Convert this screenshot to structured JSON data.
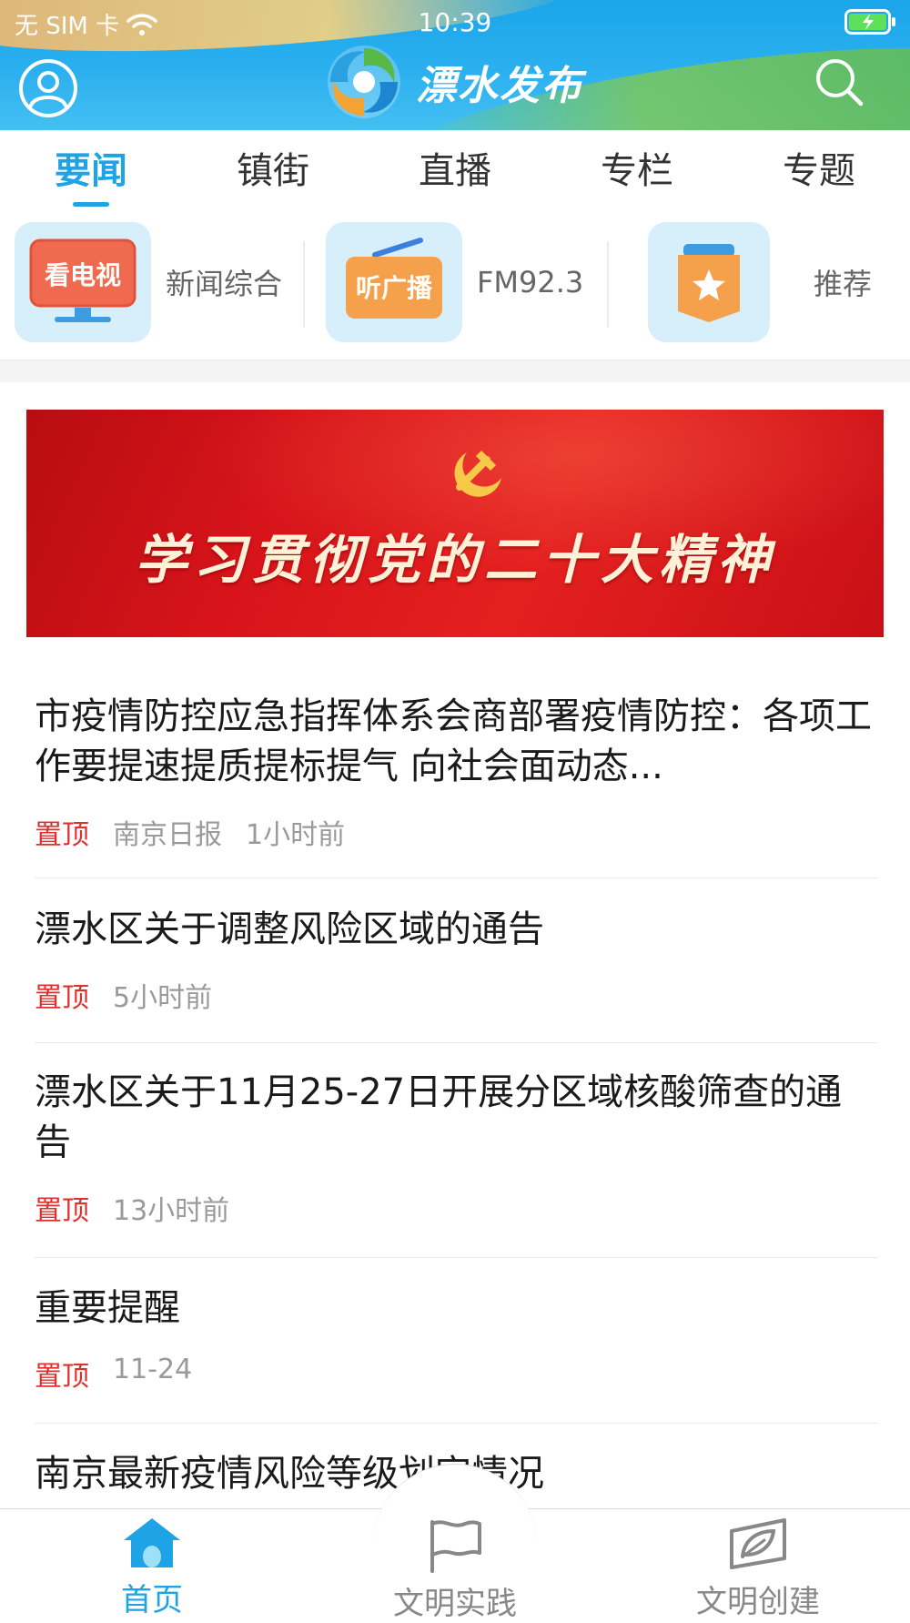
{
  "status_bar": {
    "carrier": "无 SIM 卡",
    "time": "10:39"
  },
  "header": {
    "app_title": "漂水发布",
    "icons": [
      "avatar-icon",
      "search-icon",
      "logo-icon"
    ]
  },
  "tabs": [
    {
      "label": "要闻",
      "active": true
    },
    {
      "label": "镇街",
      "active": false
    },
    {
      "label": "直播",
      "active": false
    },
    {
      "label": "专栏",
      "active": false
    },
    {
      "label": "专题",
      "active": false
    }
  ],
  "channels": [
    {
      "icon_text": "看电视",
      "label": "新闻综合",
      "icon": "tv-icon"
    },
    {
      "icon_text": "听广播",
      "label": "FM92.3",
      "icon": "radio-icon"
    },
    {
      "icon_text": "",
      "label": "推荐",
      "icon": "star-bookmark-icon"
    }
  ],
  "banner": {
    "title": "学习贯彻党的二十大精神",
    "colors": {
      "background": "#d7141a",
      "text": "#fff1d8"
    }
  },
  "news": [
    {
      "title": "市疫情防控应急指挥体系会商部署疫情防控：各项工作要提速提质提标提气 向社会面动态...",
      "pin": "置顶",
      "source": "南京日报",
      "time": "1小时前"
    },
    {
      "title": "漂水区关于调整风险区域的通告",
      "pin": "置顶",
      "source": "",
      "time": "5小时前"
    },
    {
      "title": "漂水区关于11月25-27日开展分区域核酸筛查的通告",
      "pin": "置顶",
      "source": "",
      "time": "13小时前"
    },
    {
      "title": "重要提醒",
      "pin": "置顶",
      "source": "",
      "time": "11-24"
    },
    {
      "title": "南京最新疫情风险等级划定情况",
      "pin": "",
      "source": "",
      "time": ""
    }
  ],
  "bottom_nav": [
    {
      "label": "首页",
      "icon": "home-icon",
      "active": true
    },
    {
      "label": "文明实践",
      "icon": "flag-icon",
      "active": false
    },
    {
      "label": "文明创建",
      "icon": "leaf-box-icon",
      "active": false
    }
  ],
  "colors": {
    "accent": "#1da3e6",
    "pin_red": "#e0302e",
    "meta_gray": "#9a9a9a"
  }
}
